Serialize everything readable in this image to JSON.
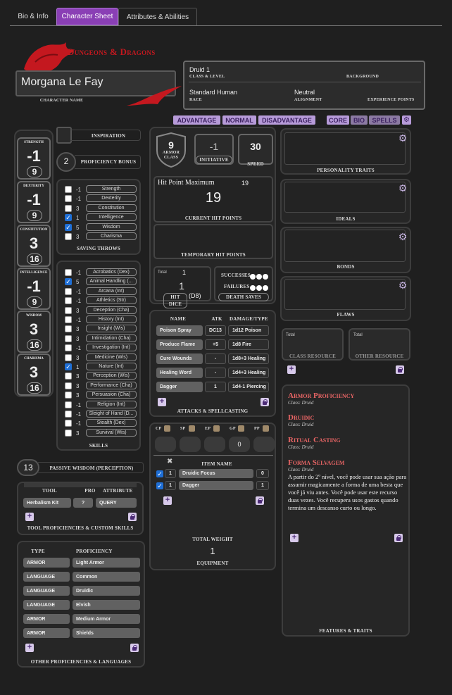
{
  "tabs": [
    {
      "label": "Bio & Info"
    },
    {
      "label": "Character Sheet"
    },
    {
      "label": "Attributes & Abilities"
    }
  ],
  "colors": {
    "accent": "#8a3fb5",
    "feature_title": "#e96565",
    "toggle": "#b79bd9",
    "logo_red": "#c4181f"
  },
  "header": {
    "logo_text": "Dungeons & Dragons",
    "character_name": "Morgana Le Fay",
    "character_name_label": "CHARACTER NAME",
    "class_level": "Druid 1",
    "class_level_label": "CLASS & LEVEL",
    "background_label": "BACKGROUND",
    "race": "Standard Human",
    "race_label": "RACE",
    "alignment": "Neutral",
    "alignment_label": "ALIGNMENT",
    "xp_label": "EXPERIENCE POINTS"
  },
  "toggles": {
    "advantage": "ADVANTAGE",
    "normal": "NORMAL",
    "disadvantage": "DISADVANTAGE",
    "core": "CORE",
    "bio": "BIO",
    "spells": "SPELLS"
  },
  "attributes": [
    {
      "label": "STRENGTH",
      "mod": "-1",
      "score": "9"
    },
    {
      "label": "DEXTERITY",
      "mod": "-1",
      "score": "9"
    },
    {
      "label": "CONSTITUTION",
      "mod": "3",
      "score": "16"
    },
    {
      "label": "INTELLIGENCE",
      "mod": "-1",
      "score": "9"
    },
    {
      "label": "WISDOM",
      "mod": "3",
      "score": "16"
    },
    {
      "label": "CHARISMA",
      "mod": "3",
      "score": "16"
    }
  ],
  "inspiration_label": "INSPIRATION",
  "proficiency": {
    "value": "2",
    "label": "PROFICIENCY BONUS"
  },
  "saving_throws": {
    "label": "SAVING THROWS",
    "items": [
      {
        "value": "-1",
        "name": "Strength",
        "checked": false
      },
      {
        "value": "-1",
        "name": "Dexterity",
        "checked": false
      },
      {
        "value": "3",
        "name": "Constitution",
        "checked": false
      },
      {
        "value": "1",
        "name": "Intelligence",
        "checked": true
      },
      {
        "value": "5",
        "name": "Wisdom",
        "checked": true
      },
      {
        "value": "3",
        "name": "Charisma",
        "checked": false
      }
    ]
  },
  "skills": {
    "label": "SKILLS",
    "items": [
      {
        "value": "-1",
        "name": "Acrobatics (Dex)",
        "checked": false
      },
      {
        "value": "5",
        "name": "Animal Handling (...",
        "checked": true
      },
      {
        "value": "-1",
        "name": "Arcana (Int)",
        "checked": false
      },
      {
        "value": "-1",
        "name": "Athletics (Str)",
        "checked": false
      },
      {
        "value": "3",
        "name": "Deception (Cha)",
        "checked": false
      },
      {
        "value": "-1",
        "name": "History (Int)",
        "checked": false
      },
      {
        "value": "3",
        "name": "Insight (Wis)",
        "checked": false
      },
      {
        "value": "3",
        "name": "Intimidation (Cha)",
        "checked": false
      },
      {
        "value": "-1",
        "name": "Investigation (Int)",
        "checked": false
      },
      {
        "value": "3",
        "name": "Medicine (Wis)",
        "checked": false
      },
      {
        "value": "1",
        "name": "Nature (Int)",
        "checked": true
      },
      {
        "value": "3",
        "name": "Perception (Wis)",
        "checked": false
      },
      {
        "value": "3",
        "name": "Performance (Cha)",
        "checked": false
      },
      {
        "value": "3",
        "name": "Persuasion (Cha)",
        "checked": false
      },
      {
        "value": "-1",
        "name": "Religion (Int)",
        "checked": false
      },
      {
        "value": "-1",
        "name": "Sleight of Hand (D...",
        "checked": false
      },
      {
        "value": "-1",
        "name": "Stealth (Dex)",
        "checked": false
      },
      {
        "value": "3",
        "name": "Survival (Wis)",
        "checked": false
      }
    ]
  },
  "passive_wisdom": {
    "value": "13",
    "label": "PASSIVE WISDOM (PERCEPTION)"
  },
  "tools": {
    "header_tool": "TOOL",
    "header_pro": "PRO",
    "header_attr": "ATTRIBUTE",
    "rows": [
      {
        "name": "Herbalism Kit",
        "pro": "?",
        "attr": "QUERY"
      }
    ],
    "label": "TOOL PROFICIENCIES & CUSTOM SKILLS"
  },
  "other_prof": {
    "header_type": "TYPE",
    "header_prof": "PROFICIENCY",
    "rows": [
      {
        "type": "ARMOR",
        "prof": "Light Armor"
      },
      {
        "type": "LANGUAGE",
        "prof": "Common"
      },
      {
        "type": "LANGUAGE",
        "prof": "Druidic"
      },
      {
        "type": "LANGUAGE",
        "prof": "Elvish"
      },
      {
        "type": "ARMOR",
        "prof": "Medium Armor"
      },
      {
        "type": "ARMOR",
        "prof": "Shields"
      }
    ],
    "label": "OTHER PROFICIENCIES & LANGUAGES"
  },
  "combat": {
    "ac": "9",
    "ac_label1": "ARMOR",
    "ac_label2": "CLASS",
    "initiative": "-1",
    "initiative_label": "INITIATIVE",
    "speed": "30",
    "speed_label": "SPEED",
    "hp_max_label": "Hit Point Maximum",
    "hp_max": "19",
    "hp_current": "19",
    "hp_current_label": "CURRENT HIT POINTS",
    "temp_hp_label": "TEMPORARY HIT POINTS",
    "hd_total_label": "Total",
    "hd_total": "1",
    "hd_value": "1",
    "hd_label": "HIT DICE",
    "hd_die": "(D8)",
    "successes_label": "SUCCESSES",
    "failures_label": "FAILURES",
    "death_saves_label": "DEATH SAVES"
  },
  "attacks": {
    "header_name": "NAME",
    "header_atk": "ATK",
    "header_dmg": "DAMAGE/TYPE",
    "rows": [
      {
        "name": "Poison Spray",
        "atk": "DC13",
        "dmg": "1d12 Poison"
      },
      {
        "name": "Produce Flame",
        "atk": "+5",
        "dmg": "1d8 Fire"
      },
      {
        "name": "Cure Wounds",
        "atk": "-",
        "dmg": "1d8+3 Healing"
      },
      {
        "name": "Healing Word",
        "atk": "-",
        "dmg": "1d4+3 Healing"
      },
      {
        "name": "Dagger",
        "atk": "1",
        "dmg": "1d4-1 Piercing"
      }
    ],
    "label": "ATTACKS & SPELLCASTING"
  },
  "equipment": {
    "coins": [
      {
        "label": "CP",
        "value": ""
      },
      {
        "label": "SP",
        "value": ""
      },
      {
        "label": "EP",
        "value": ""
      },
      {
        "label": "GP",
        "value": "0"
      },
      {
        "label": "PP",
        "value": ""
      }
    ],
    "item_name_header": "ITEM NAME",
    "items": [
      {
        "qty": "1",
        "name": "Druidic Focus",
        "weight": "0",
        "checked": true
      },
      {
        "qty": "1",
        "name": "Dagger",
        "weight": "1",
        "checked": true
      }
    ],
    "total_weight_label": "TOTAL WEIGHT",
    "total_weight": "1",
    "label": "EQUIPMENT"
  },
  "traits": {
    "personality": "PERSONALITY TRAITS",
    "ideals": "IDEALS",
    "bonds": "BONDS",
    "flaws": "FLAWS"
  },
  "resources": {
    "total_label": "Total",
    "class_resource": "CLASS RESOURCE",
    "other_resource": "OTHER RESOURCE"
  },
  "features": {
    "items": [
      {
        "title": "Armor Proficiency",
        "class": "Class: Druid",
        "desc": ""
      },
      {
        "title": "Druidic",
        "class": "Class: Druid",
        "desc": ""
      },
      {
        "title": "Ritual Casting",
        "class": "Class: Druid",
        "desc": ""
      },
      {
        "title": "Forma Selvagem",
        "class": "Class: Druid",
        "desc": "A partir do 2º nível, você pode usar sua ação para assumir magicamente a forma de uma besta que você já viu antes. Você pode usar este recurso duas vezes. Você recupera usos gastos quando termina um descanso curto ou longo."
      }
    ],
    "label": "FEATURES & TRAITS"
  }
}
